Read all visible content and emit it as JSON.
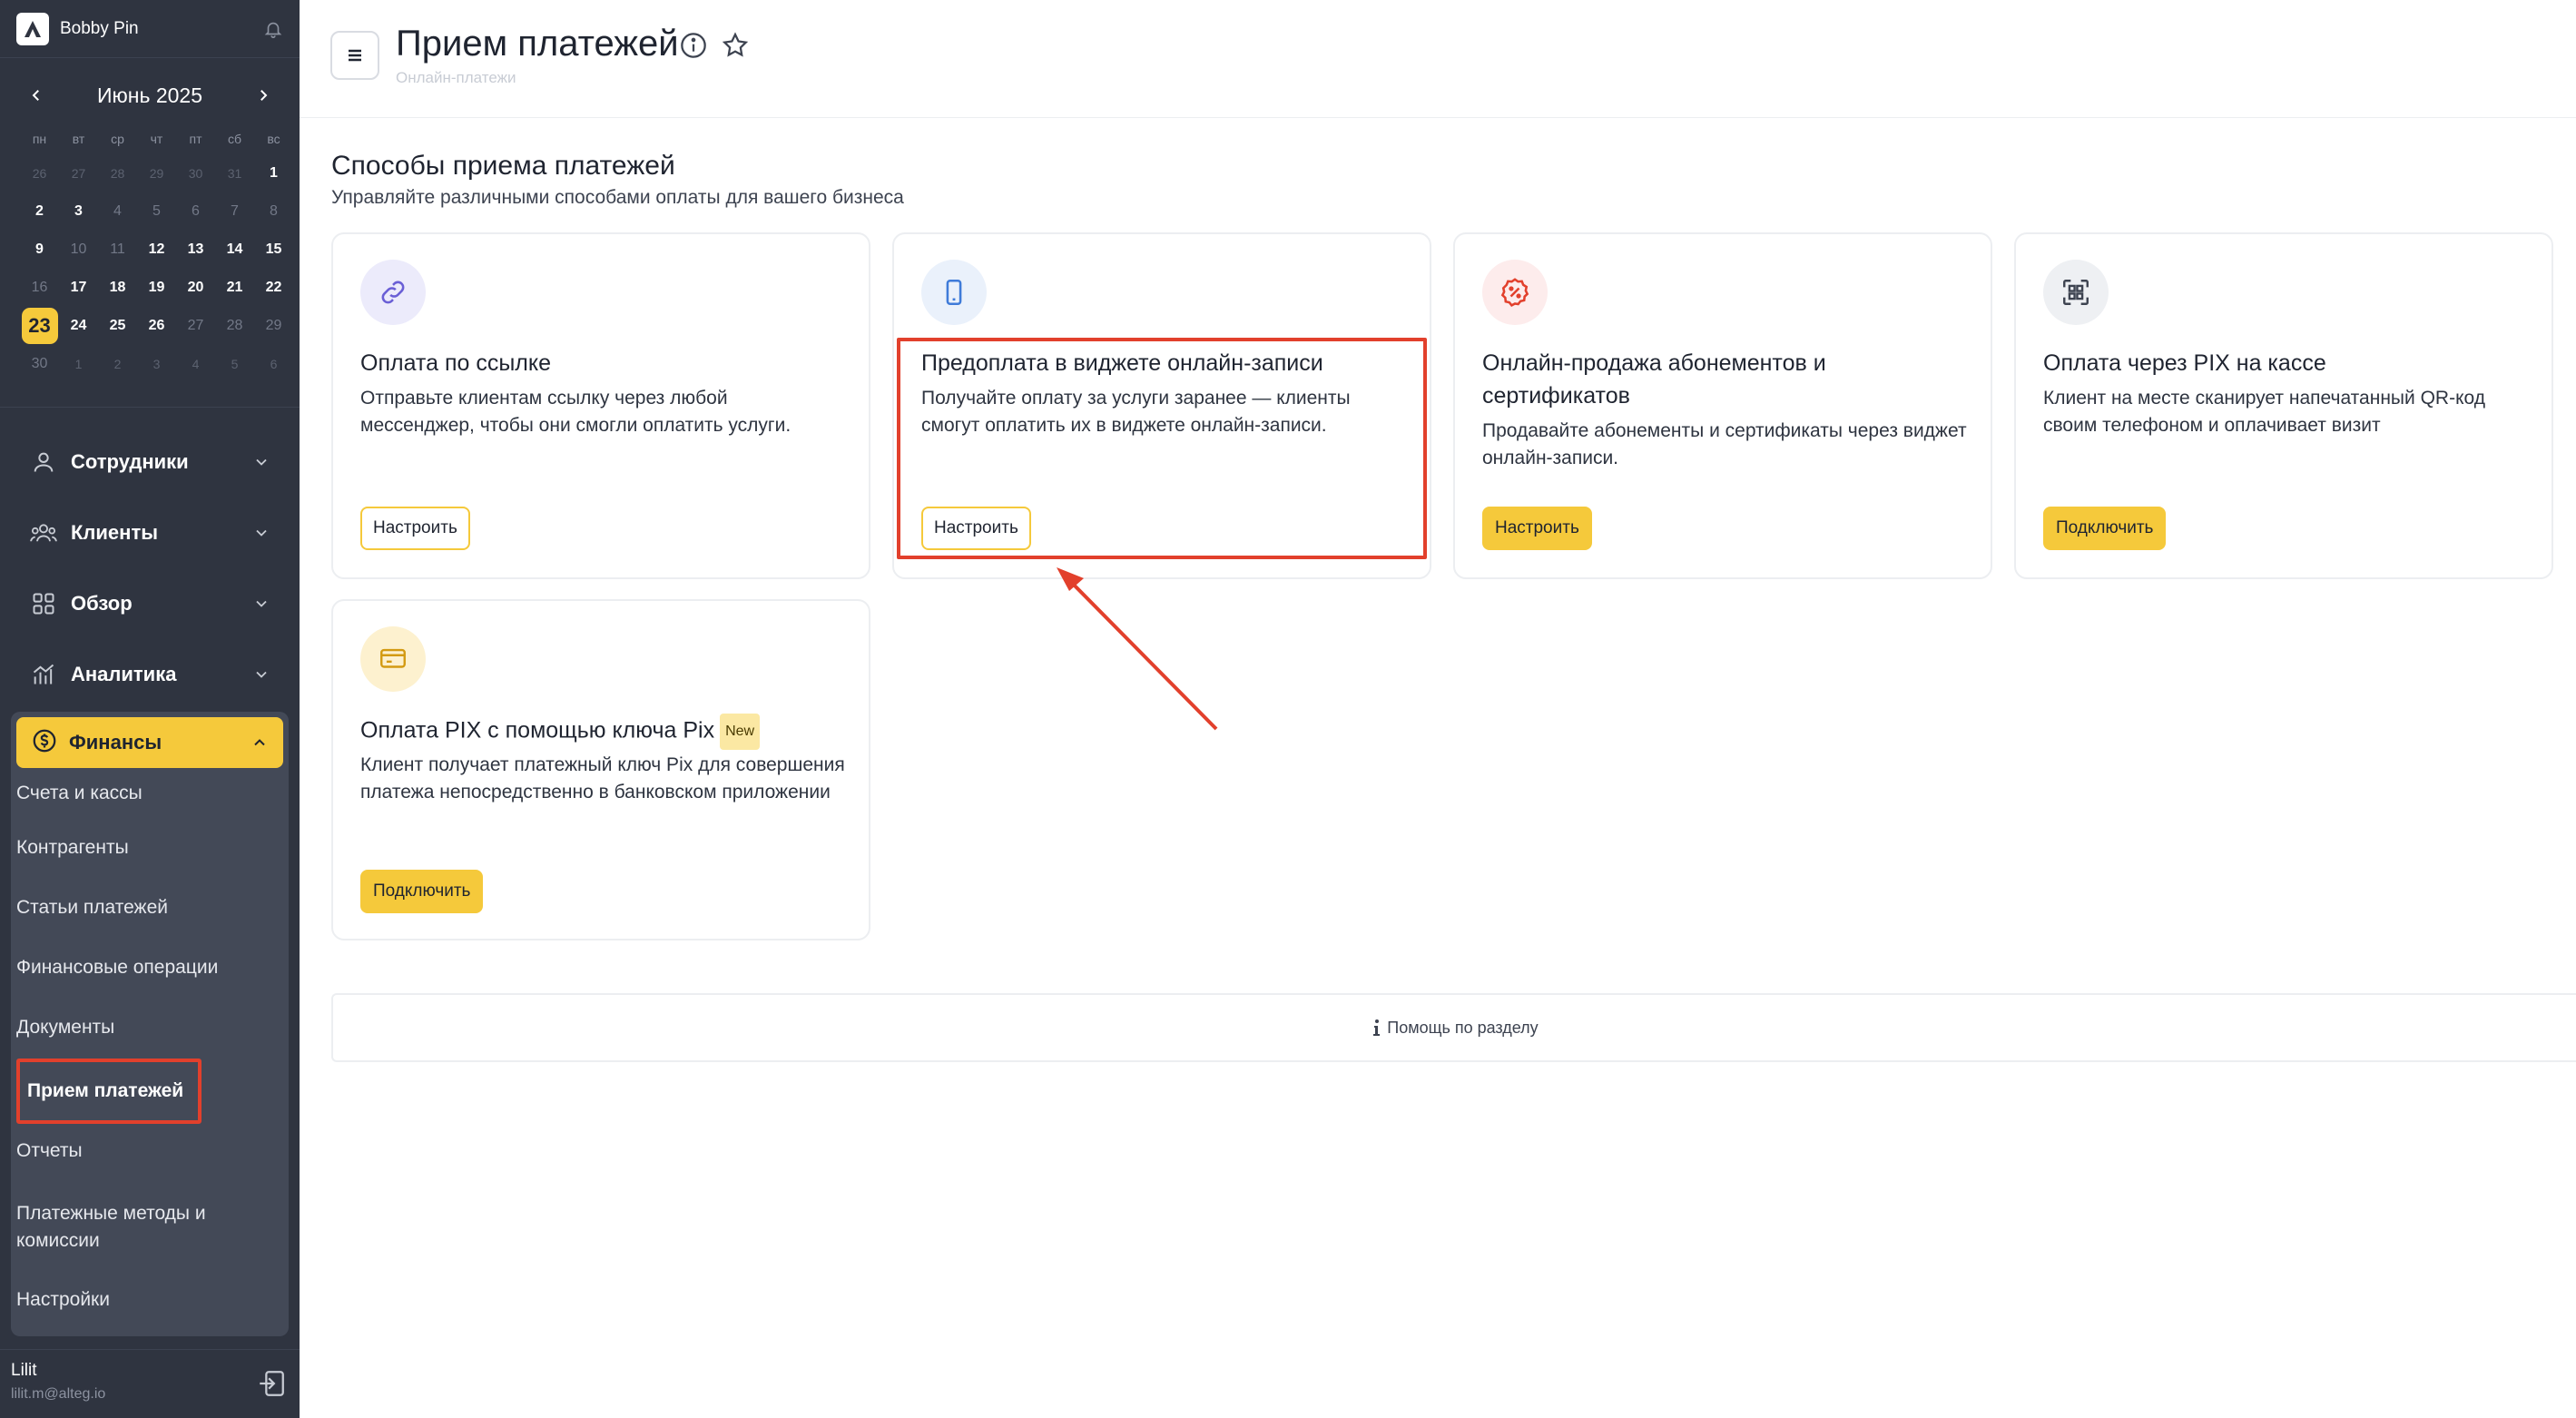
{
  "sidebar": {
    "company": "Bobby Pin",
    "calendar": {
      "month_label": "Июнь 2025",
      "weekdays": [
        "пн",
        "вт",
        "ср",
        "чт",
        "пт",
        "сб",
        "вс"
      ],
      "weeks": [
        [
          {
            "d": "26",
            "t": "out"
          },
          {
            "d": "27",
            "t": "out"
          },
          {
            "d": "28",
            "t": "out"
          },
          {
            "d": "29",
            "t": "out"
          },
          {
            "d": "30",
            "t": "out"
          },
          {
            "d": "31",
            "t": "out"
          },
          {
            "d": "1",
            "t": "cur"
          }
        ],
        [
          {
            "d": "2",
            "t": "cur"
          },
          {
            "d": "3",
            "t": "cur"
          },
          {
            "d": "4",
            "t": "dim"
          },
          {
            "d": "5",
            "t": "dim"
          },
          {
            "d": "6",
            "t": "dim"
          },
          {
            "d": "7",
            "t": "dim"
          },
          {
            "d": "8",
            "t": "dim"
          }
        ],
        [
          {
            "d": "9",
            "t": "cur"
          },
          {
            "d": "10",
            "t": "dim"
          },
          {
            "d": "11",
            "t": "dim"
          },
          {
            "d": "12",
            "t": "cur"
          },
          {
            "d": "13",
            "t": "cur"
          },
          {
            "d": "14",
            "t": "cur"
          },
          {
            "d": "15",
            "t": "cur"
          }
        ],
        [
          {
            "d": "16",
            "t": "dim"
          },
          {
            "d": "17",
            "t": "cur"
          },
          {
            "d": "18",
            "t": "cur"
          },
          {
            "d": "19",
            "t": "cur"
          },
          {
            "d": "20",
            "t": "cur"
          },
          {
            "d": "21",
            "t": "cur"
          },
          {
            "d": "22",
            "t": "cur"
          }
        ],
        [
          {
            "d": "23",
            "t": "today"
          },
          {
            "d": "24",
            "t": "cur"
          },
          {
            "d": "25",
            "t": "cur"
          },
          {
            "d": "26",
            "t": "cur"
          },
          {
            "d": "27",
            "t": "dim"
          },
          {
            "d": "28",
            "t": "dim"
          },
          {
            "d": "29",
            "t": "dim"
          }
        ],
        [
          {
            "d": "30",
            "t": "dim"
          },
          {
            "d": "1",
            "t": "out"
          },
          {
            "d": "2",
            "t": "out"
          },
          {
            "d": "3",
            "t": "out"
          },
          {
            "d": "4",
            "t": "out"
          },
          {
            "d": "5",
            "t": "out"
          },
          {
            "d": "6",
            "t": "out"
          }
        ]
      ]
    },
    "nav": {
      "staff": "Сотрудники",
      "clients": "Клиенты",
      "overview": "Обзор",
      "analytics": "Аналитика",
      "finance": "Финансы"
    },
    "finance_sub": {
      "accounts": "Счета и кассы",
      "counterparties": "Контрагенты",
      "payment_items": "Статьи платежей",
      "operations": "Финансовые операции",
      "documents": "Документы",
      "payments": "Прием платежей",
      "reports": "Отчеты",
      "methods_line1": "Платежные методы и",
      "methods_line2": "комиссии",
      "settings": "Настройки"
    },
    "user": {
      "name": "Lilit",
      "email": "lilit.m@alteg.io"
    }
  },
  "header": {
    "title": "Прием платежей",
    "breadcrumb": "Онлайн-платежи"
  },
  "section": {
    "title": "Способы приема платежей",
    "subtitle": "Управляйте различными способами оплаты для вашего бизнеса"
  },
  "cards": {
    "link": {
      "title": "Оплата по ссылке",
      "desc": "Отправьте клиентам ссылку через любой мессенджер, чтобы они смогли оплатить услуги.",
      "button": "Настроить"
    },
    "widget": {
      "title": "Предоплата в виджете онлайн-записи",
      "desc": "Получайте оплату за услуги заранее — клиенты смогут оплатить их в виджете онлайн-записи.",
      "button": "Настроить"
    },
    "subscriptions": {
      "title": "Онлайн-продажа абонементов и сертификатов",
      "desc": "Продавайте абонементы и сертификаты через виджет онлайн-записи.",
      "button": "Настроить"
    },
    "pix_cashier": {
      "title": "Оплата через PIX на кассе",
      "desc": "Клиент на месте сканирует напечатанный QR-код своим телефоном и оплачивает визит",
      "button": "Подключить"
    },
    "pix_key": {
      "title": "Оплата PIX с помощью ключа Pix",
      "badge": "New",
      "desc": "Клиент получает платежный ключ Pix для совершения платежа непосредственно в банковском приложении",
      "button": "Подключить"
    }
  },
  "help": {
    "label": "Помощь по разделу"
  },
  "colors": {
    "accent": "#f5c93b",
    "annotation": "#e2402c",
    "sidebar": "#2f3440"
  }
}
